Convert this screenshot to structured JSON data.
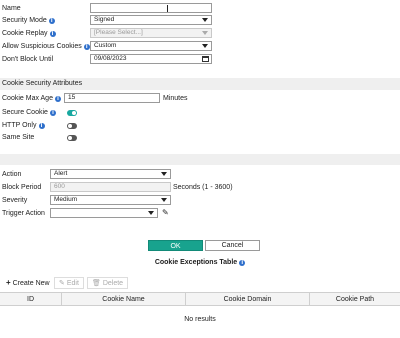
{
  "form": {
    "name": {
      "label": "Name",
      "value": ""
    },
    "security_mode": {
      "label": "Security Mode",
      "value": "Signed"
    },
    "cookie_replay": {
      "label": "Cookie Replay",
      "placeholder": "[Please Select...]"
    },
    "allow_suspicious_cookies": {
      "label": "Allow Suspicious Cookies",
      "value": "Custom"
    },
    "dont_block_until": {
      "label": "Don't Block Until",
      "value": "09/08/2023"
    }
  },
  "cookie_attributes": {
    "section_title": "Cookie Security Attributes",
    "max_age": {
      "label": "Cookie Max Age",
      "value": "15",
      "unit": "Minutes"
    },
    "secure_cookie": {
      "label": "Secure Cookie",
      "enabled": true
    },
    "http_only": {
      "label": "HTTP Only",
      "enabled": false
    },
    "same_site": {
      "label": "Same Site",
      "enabled": false
    }
  },
  "action_section": {
    "action": {
      "label": "Action",
      "value": "Alert"
    },
    "block_period": {
      "label": "Block Period",
      "value": "600",
      "unit": "Seconds (1 - 3600)"
    },
    "severity": {
      "label": "Severity",
      "value": "Medium"
    },
    "trigger_action": {
      "label": "Trigger Action",
      "value": ""
    }
  },
  "buttons": {
    "ok": "OK",
    "cancel": "Cancel"
  },
  "exceptions_table": {
    "title": "Cookie Exceptions Table",
    "toolbar": {
      "create": "Create New",
      "edit": "Edit",
      "delete": "Delete"
    },
    "columns": [
      "ID",
      "Cookie Name",
      "Cookie Domain",
      "Cookie Path"
    ],
    "empty_text": "No results"
  },
  "icons": {
    "info": "info-icon",
    "edit": "pencil-icon",
    "calendar": "calendar-icon"
  },
  "colors": {
    "accent": "#18a38e",
    "toggle_on": "#18a8a0",
    "info": "#2e6fcb"
  }
}
